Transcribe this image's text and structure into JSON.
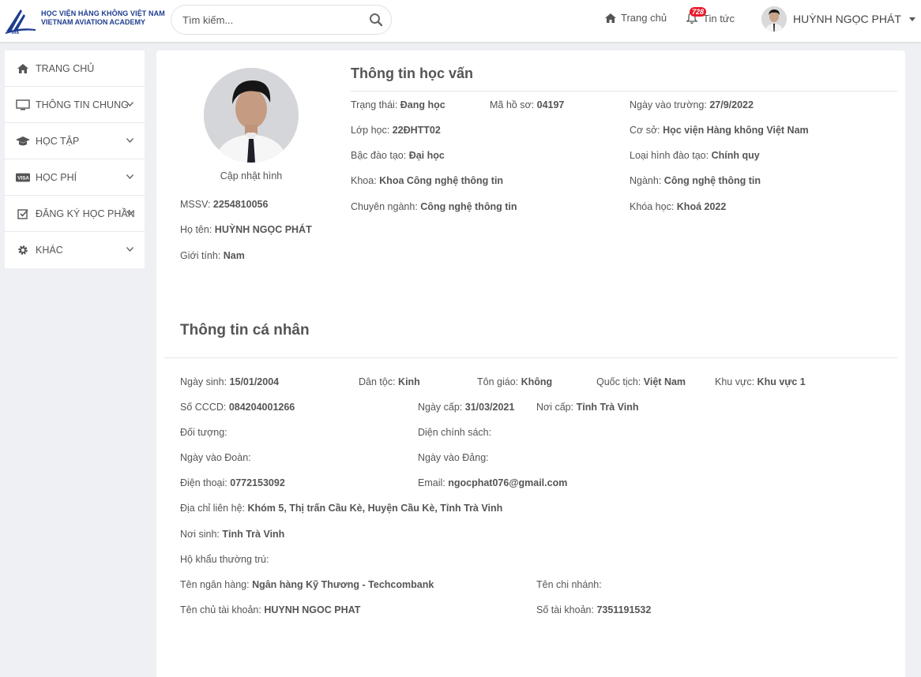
{
  "header": {
    "logo_line1": "HỌC VIỆN HÀNG KHÔNG VIỆT NAM",
    "logo_line2": "VIETNAM AVIATION ACADEMY",
    "search_placeholder": "Tìm kiếm...",
    "nav_home": "Trang chủ",
    "nav_news": "Tin tức",
    "news_badge": "728",
    "user_name": "HUỲNH NGỌC PHÁT"
  },
  "sidebar": {
    "items": [
      {
        "label": "TRANG CHỦ",
        "icon": "home-icon"
      },
      {
        "label": "THÔNG TIN CHUNG",
        "icon": "monitor-icon"
      },
      {
        "label": "HỌC TẬP",
        "icon": "graduation-cap-icon"
      },
      {
        "label": "HỌC PHÍ",
        "icon": "visa-card-icon"
      },
      {
        "label": "ĐĂNG KÝ HỌC PHẦN",
        "icon": "check-square-icon"
      },
      {
        "label": "KHÁC",
        "icon": "gear-icon"
      }
    ]
  },
  "profile": {
    "update_photo": "Cập nhật hình",
    "mssv_label": "MSSV:",
    "mssv": "2254810056",
    "name_label": "Họ tên:",
    "name": "HUỲNH NGỌC PHÁT",
    "gender_label": "Giới tính:",
    "gender": "Nam"
  },
  "education": {
    "title": "Thông tin học vấn",
    "status_label": "Trạng thái:",
    "status": "Đang học",
    "file_label": "Mã hồ sơ:",
    "file": "04197",
    "entry_label": "Ngày vào trường:",
    "entry": "27/9/2022",
    "class_label": "Lớp học:",
    "class": "22ĐHTT02",
    "campus_label": "Cơ sở:",
    "campus": "Học viện Hàng không Việt Nam",
    "level_label": "Bậc đào tạo:",
    "level": "Đại học",
    "type_label": "Loại hình đào tạo:",
    "type": "Chính quy",
    "faculty_label": "Khoa:",
    "faculty": "Khoa Công nghệ thông tin",
    "major_label": "Ngành:",
    "major": "Công nghệ thông tin",
    "spec_label": "Chuyên ngành:",
    "spec": "Công nghệ thông tin",
    "course_label": "Khóa học:",
    "course": "Khoá 2022"
  },
  "personal": {
    "title": "Thông tin cá nhân",
    "dob_label": "Ngày sinh:",
    "dob": "15/01/2004",
    "ethnic_label": "Dân tộc:",
    "ethnic": "Kinh",
    "religion_label": "Tôn giáo:",
    "religion": "Không",
    "nationality_label": "Quốc tịch:",
    "nationality": "Việt Nam",
    "region_label": "Khu vực:",
    "region": "Khu vực 1",
    "id_label": "Số CCCD:",
    "id": "084204001266",
    "issue_date_label": "Ngày cấp:",
    "issue_date": "31/03/2021",
    "issue_place_label": "Nơi cấp:",
    "issue_place": "Tỉnh Trà Vinh",
    "object_label": "Đối tượng:",
    "policy_label": "Diện chính sách:",
    "union_label": "Ngày vào Đoàn:",
    "party_label": "Ngày vào Đảng:",
    "phone_label": "Điện thoại:",
    "phone": "0772153092",
    "email_label": "Email:",
    "email": "ngocphat076@gmail.com",
    "address_label": "Địa chỉ liên hệ:",
    "address": "Khóm 5, Thị trấn Cầu Kè, Huyện Cầu Kè, Tỉnh Trà Vinh",
    "birthplace_label": "Nơi sinh:",
    "birthplace": "Tỉnh Trà Vinh",
    "residence_label": "Hộ khẩu thường trú:",
    "bank_label": "Tên ngân hàng:",
    "bank": "Ngân hàng Kỹ Thương - Techcombank",
    "branch_label": "Tên chi nhánh:",
    "holder_label": "Tên chủ tài khoản:",
    "holder": "HUYNH NGOC PHAT",
    "account_label": "Số tài khoản:",
    "account": "7351191532"
  }
}
